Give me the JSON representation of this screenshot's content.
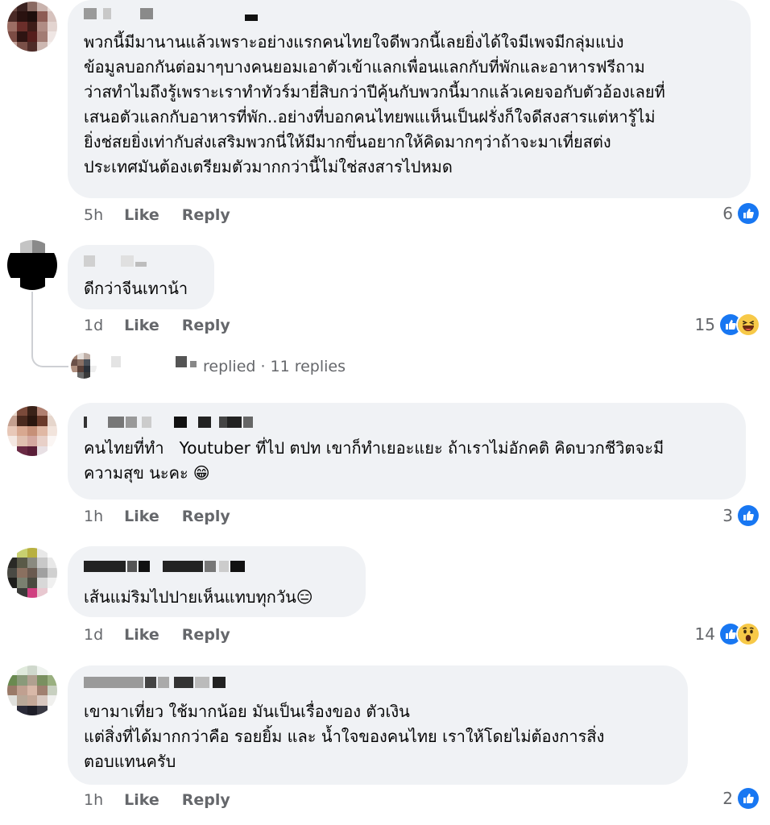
{
  "comments": [
    {
      "text": "พวกนี้มีมานานแล้วเพราะอย่างแรกคนไทยใจดีพวกนี้เลยยิ่งได้ใจมีเพจมีกลุ่มแบ่ง\nข้อมูลบอกกันต่อมาๆบางคนยอมเอาตัวเข้าแลกเพื่อนแลกกับที่พักและอาหารฟรีถาม\nว่าสทำไมถึงรู้เพราะเราทำทัวร์มายี่สิบกว่าปีคุ้นกับพวกนี้มากแล้วเคยจอกับตัวอ้องเลยที่\nเสนอตัวแลกกับอาหารที่พัก..อย่างที่บอกคนไทยพแเห็นเป็นฝรั่งก็ใจดีสงสารแต่หารู้ไม่\nยิ่งช่สยยิ่งเท่ากับส่งเสริมพวกนี่ให้มีมากขึ่นอยากให้คิดมากๆว่าถ้าจะมาเที่ยสต่ง\nประเทศมันต้องเตรียมตัวมากกว่านี้ไม่ใช่สงสารไปหมด",
      "time": "5h",
      "like": "Like",
      "reply": "Reply",
      "count": "6",
      "reactions": [
        "like-icon"
      ]
    },
    {
      "text": "ดีกว่าจีนเทาน้า",
      "time": "1d",
      "like": "Like",
      "reply": "Reply",
      "count": "15",
      "reactions": [
        "like-icon",
        "laugh-icon"
      ],
      "replies": {
        "text": "replied",
        "sep": "·",
        "count": "11 replies"
      }
    },
    {
      "text": "คนไทยที่ทำ   Youtuber ที่ไป ตปท เขาก็ทำเยอะแยะ ถ้าเราไม่อักคติ คิดบวกชีวิตจะมี\nความสุข นะคะ",
      "emoji": "😁",
      "time": "1h",
      "like": "Like",
      "reply": "Reply",
      "count": "3",
      "reactions": [
        "like-icon"
      ]
    },
    {
      "text": "เส้นแม่ริมไปปายเห็นแทบทุกวัน",
      "emoji": "😑",
      "time": "1d",
      "like": "Like",
      "reply": "Reply",
      "count": "14",
      "reactions": [
        "like-icon",
        "wow-icon"
      ]
    },
    {
      "text": "เขามาเที่ยว ใช้มากน้อย มันเป็นเรื่องของ ตัวเงิน\nแต่สิ่งที่ได้มากกว่าคือ รอยยิ้ม และ น้ำใจของคนไทย เราให้โดยไม่ต้องการสิ่ง\nตอบแทนครับ",
      "time": "1h",
      "like": "Like",
      "reply": "Reply",
      "count": "2",
      "reactions": [
        "like-icon"
      ]
    }
  ],
  "colors": {
    "bubble": "#f0f2f5",
    "meta": "#65676b",
    "like_blue": "#1877f2",
    "emoji_yellow": "#f7c948"
  }
}
